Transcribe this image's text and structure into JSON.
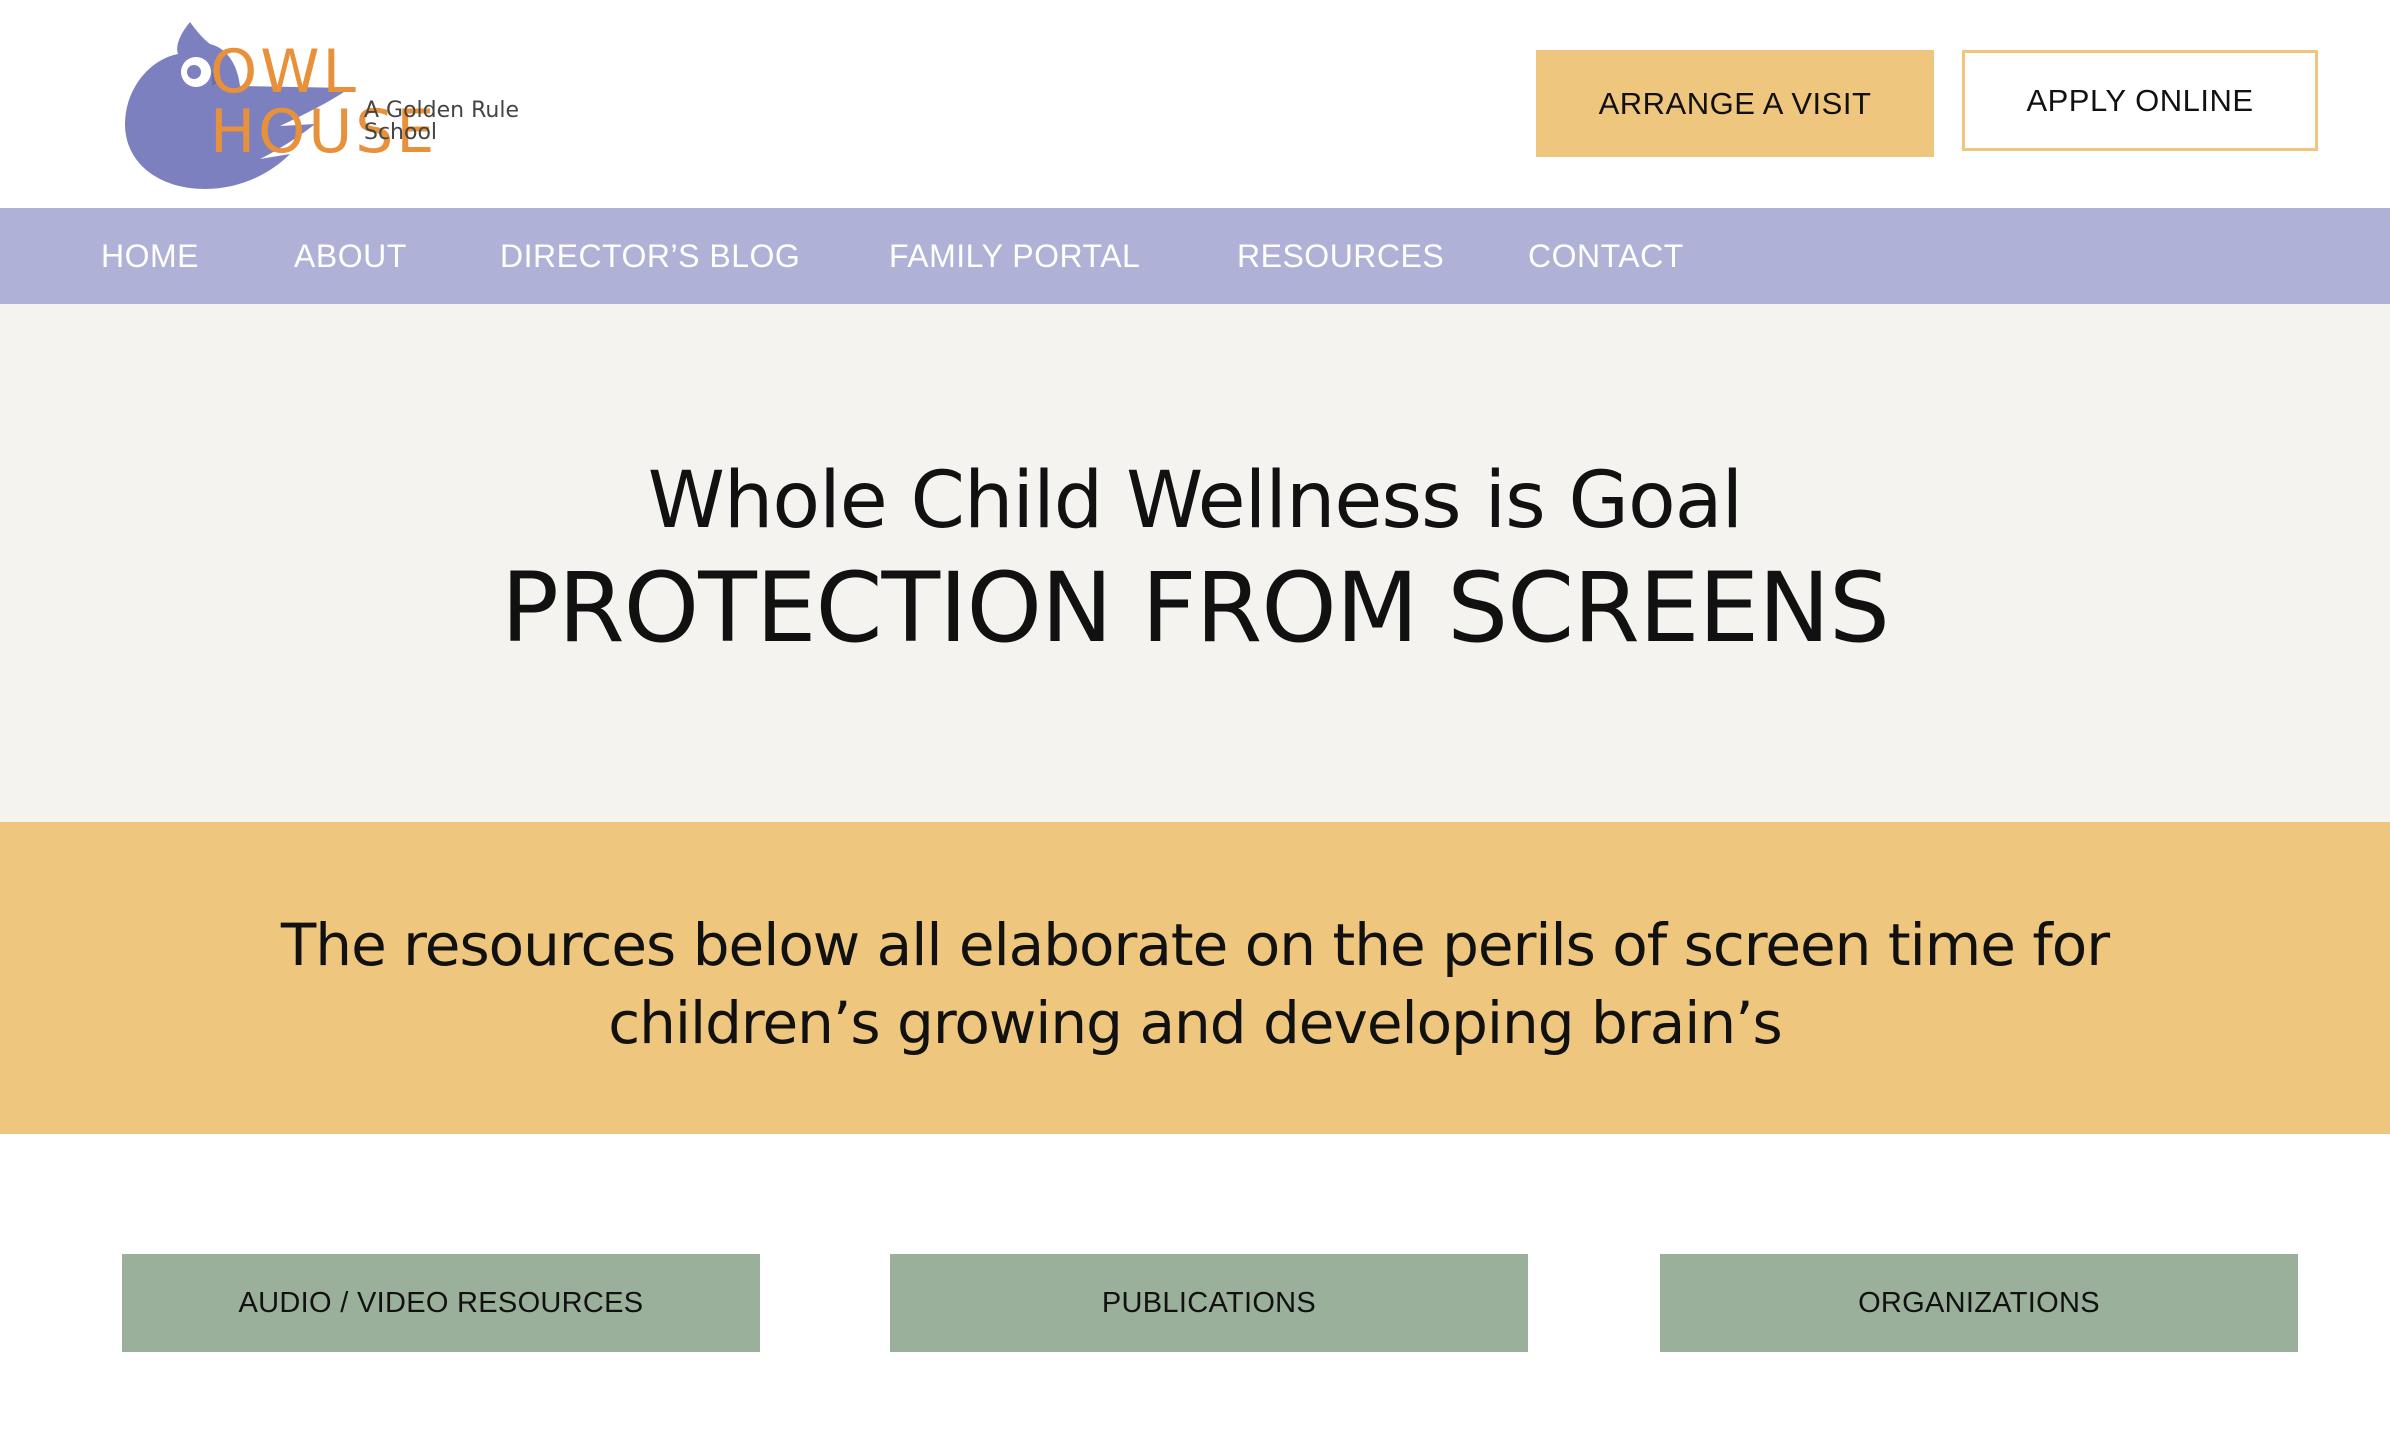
{
  "header": {
    "logo": {
      "title": "OWL HOUSE",
      "subtitle": "A Golden Rule School",
      "icon": "owl-icon"
    },
    "buttons": {
      "arrange_visit": "ARRANGE A VISIT",
      "apply_online": "APPLY ONLINE"
    }
  },
  "nav": {
    "items": [
      {
        "label": "HOME"
      },
      {
        "label": "ABOUT"
      },
      {
        "label": "DIRECTOR’S BLOG"
      },
      {
        "label": "FAMILY PORTAL"
      },
      {
        "label": "RESOURCES"
      },
      {
        "label": "CONTACT"
      }
    ]
  },
  "hero": {
    "subtitle": "Whole Child Wellness is Goal",
    "title": "PROTECTION FROM SCREENS"
  },
  "banner": {
    "text": "The resources below all elaborate on the perils of screen time for children’s growing and developing brain’s"
  },
  "resources": {
    "buttons": [
      {
        "label": "AUDIO / VIDEO RESOURCES"
      },
      {
        "label": "PUBLICATIONS"
      },
      {
        "label": "ORGANIZATIONS"
      }
    ]
  },
  "colors": {
    "brand_orange": "#e8913a",
    "owl_purple": "#7d80bf",
    "nav_bg": "#afb2d6",
    "gold": "#eec67e",
    "hero_bg": "#f4f3ef",
    "sage": "#9ab09a"
  }
}
